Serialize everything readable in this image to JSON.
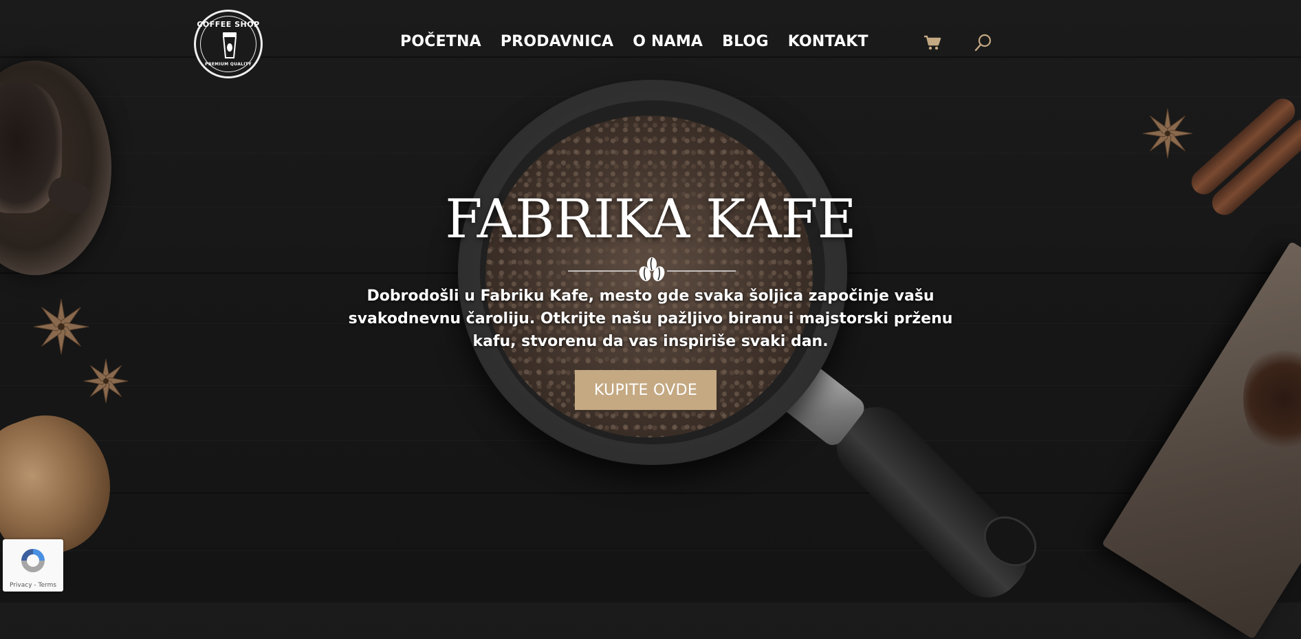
{
  "logo": {
    "top_text": "COFFEE SHOP",
    "bottom_text": "PREMIUM QUALITY"
  },
  "nav": {
    "items": [
      {
        "label": "POČETNA"
      },
      {
        "label": "PRODAVNICA"
      },
      {
        "label": "O NAMA"
      },
      {
        "label": "BLOG"
      },
      {
        "label": "KONTAKT"
      }
    ]
  },
  "header_icons": {
    "cart": "cart-icon",
    "search": "search-icon"
  },
  "hero": {
    "title": "FABRIKA KAFE",
    "text": "Dobrodošli u Fabriku Kafe, mesto gde svaka šoljica započinje vašu svakodnevnu čaroliju. Otkrijte našu pažljivo biranu i majstorski prženu kafu, stvorenu da vas inspiriše svaki dan.",
    "cta_label": "KUPITE OVDE"
  },
  "recaptcha": {
    "privacy": "Privacy",
    "separator": " - ",
    "terms": "Terms"
  },
  "colors": {
    "accent": "#c4a983",
    "background": "#181818",
    "text": "#ffffff"
  }
}
